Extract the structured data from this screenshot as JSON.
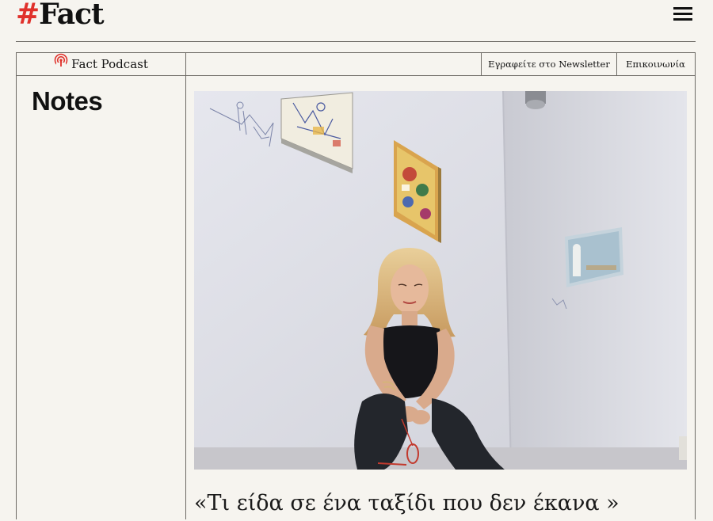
{
  "header": {
    "logo_hash": "#",
    "logo_text": "Fact",
    "menu_icon": "hamburger-menu-icon"
  },
  "nav": {
    "podcast_label": "Fact Podcast",
    "podcast_icon": "podcast-icon",
    "newsletter_label": "Εγραφείτε στο Newsletter",
    "contact_label": "Επικοινωνία"
  },
  "section": {
    "title": "Notes"
  },
  "article": {
    "title": "«Τι είδα σε ένα ταξίδι που δεν έκανα »"
  },
  "colors": {
    "accent": "#e0312b",
    "background": "#f6f4ef",
    "rule": "#6d6a65"
  }
}
